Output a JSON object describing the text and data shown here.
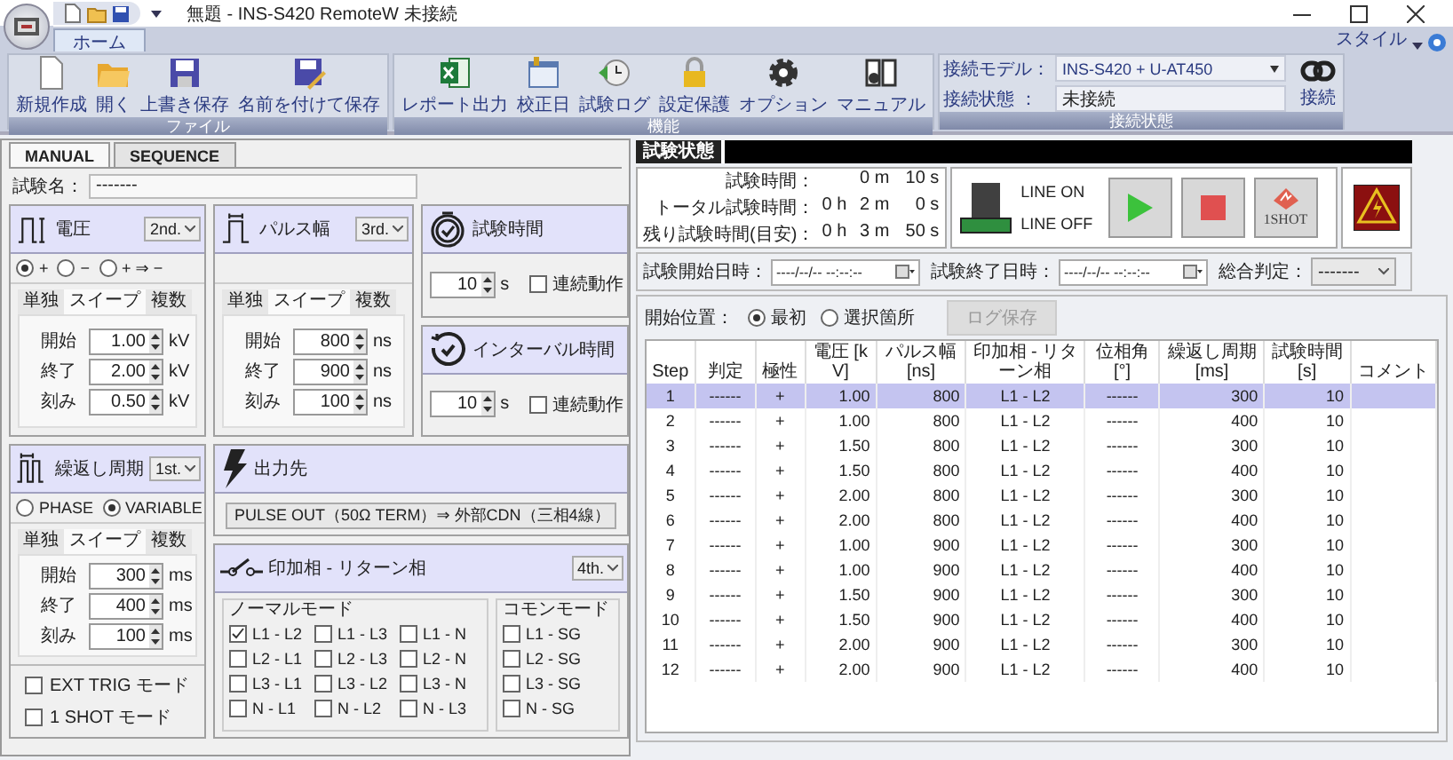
{
  "window": {
    "title": "無題 - INS-S420 RemoteW 未接続"
  },
  "ribbon": {
    "tabs": [
      {
        "label": "ホーム",
        "selected": true
      }
    ],
    "style_menu": "スタイル",
    "groups": [
      {
        "label": "ファイル",
        "buttons": [
          {
            "kind": "new",
            "label": "新規作成"
          },
          {
            "kind": "open",
            "label": "開く"
          },
          {
            "kind": "save",
            "label": "上書き保存"
          },
          {
            "kind": "save_as",
            "label": "名前を付けて保存"
          }
        ]
      },
      {
        "label": "機能",
        "buttons": [
          {
            "kind": "report",
            "label": "レポート出力"
          },
          {
            "kind": "calibration",
            "label": "校正日"
          },
          {
            "kind": "log",
            "label": "試験ログ"
          },
          {
            "kind": "lock",
            "label": "設定保護"
          },
          {
            "kind": "options",
            "label": "オプション"
          },
          {
            "kind": "manual",
            "label": "マニュアル"
          }
        ]
      }
    ],
    "connection": {
      "label": "接続状態",
      "model_label": "接続モデル：",
      "model": "INS-S420 + U-AT450",
      "state_label": "接続状態 ：",
      "state": "未接続",
      "connect": "接続"
    }
  },
  "modes": [
    {
      "label": "MANUAL",
      "selected": true
    },
    {
      "label": "SEQUENCE",
      "selected": false
    }
  ],
  "test_name": {
    "label": "試験名：",
    "value": "-------"
  },
  "parameter_panels": [
    {
      "kind": "voltage",
      "title": "電圧",
      "order": "2nd.",
      "options": [
        {
          "label": "+",
          "selected": true
        },
        {
          "label": "−",
          "selected": false
        },
        {
          "label": "+ ⇒ −",
          "selected": false
        }
      ],
      "tabs": [
        {
          "label": "単独",
          "selected": false
        },
        {
          "label": "スイープ",
          "selected": true
        },
        {
          "label": "複数",
          "selected": false
        }
      ],
      "fields": [
        {
          "label": "開始",
          "value": "1.00",
          "unit": "kV"
        },
        {
          "label": "終了",
          "value": "2.00",
          "unit": "kV"
        },
        {
          "label": "刻み",
          "value": "0.50",
          "unit": "kV"
        }
      ]
    },
    {
      "kind": "pulse_width",
      "title": "パルス幅",
      "order": "3rd.",
      "tabs": [
        {
          "label": "単独",
          "selected": false
        },
        {
          "label": "スイープ",
          "selected": true
        },
        {
          "label": "複数",
          "selected": false
        }
      ],
      "fields": [
        {
          "label": "開始",
          "value": "800",
          "unit": "ns"
        },
        {
          "label": "終了",
          "value": "900",
          "unit": "ns"
        },
        {
          "label": "刻み",
          "value": "100",
          "unit": "ns"
        }
      ]
    },
    {
      "kind": "repeat_period",
      "title": "繰返し周期",
      "order": "1st.",
      "options": [
        {
          "label": "PHASE",
          "selected": false
        },
        {
          "label": "VARIABLE",
          "selected": true
        }
      ],
      "tabs": [
        {
          "label": "単独",
          "selected": false
        },
        {
          "label": "スイープ",
          "selected": true
        },
        {
          "label": "複数",
          "selected": false
        }
      ],
      "fields": [
        {
          "label": "開始",
          "value": "300",
          "unit": "ms"
        },
        {
          "label": "終了",
          "value": "400",
          "unit": "ms"
        },
        {
          "label": "刻み",
          "value": "100",
          "unit": "ms"
        }
      ],
      "checks": [
        {
          "label": "EXT TRIG モード",
          "checked": false
        },
        {
          "label": "1 SHOT モード",
          "checked": false
        }
      ]
    }
  ],
  "timers": [
    {
      "kind": "test_time",
      "title": "試験時間",
      "value": "10",
      "unit": "s",
      "continuous": {
        "label": "連続動作",
        "checked": false
      }
    },
    {
      "kind": "interval",
      "title": "インターバル時間",
      "value": "10",
      "unit": "s",
      "continuous": {
        "label": "連続動作",
        "checked": false
      }
    }
  ],
  "output": {
    "title": "出力先",
    "value": "PULSE OUT（50Ω TERM）⇒ 外部CDN（三相4線）"
  },
  "phase": {
    "title": "印加相 - リターン相",
    "order": "4th.",
    "normal_mode": {
      "label": "ノーマルモード",
      "items": [
        {
          "label": "L1 - L2",
          "checked": true
        },
        {
          "label": "L1 - L3",
          "checked": false
        },
        {
          "label": "L1 - N",
          "checked": false
        },
        {
          "label": "L2 - L1",
          "checked": false
        },
        {
          "label": "L2 - L3",
          "checked": false
        },
        {
          "label": "L2 - N",
          "checked": false
        },
        {
          "label": "L3 - L1",
          "checked": false
        },
        {
          "label": "L3 - L2",
          "checked": false
        },
        {
          "label": "L3 - N",
          "checked": false
        },
        {
          "label": "N - L1",
          "checked": false
        },
        {
          "label": "N - L2",
          "checked": false
        },
        {
          "label": "N - L3",
          "checked": false
        }
      ]
    },
    "common_mode": {
      "label": "コモンモード",
      "items": [
        {
          "label": "L1 - SG",
          "checked": false
        },
        {
          "label": "L2 - SG",
          "checked": false
        },
        {
          "label": "L3 - SG",
          "checked": false
        },
        {
          "label": "N - SG",
          "checked": false
        }
      ]
    }
  },
  "status": {
    "title": "試験状態",
    "times": [
      {
        "label": "試験時間：",
        "m": "0 m",
        "s": "10 s"
      },
      {
        "label": "トータル試験時間：",
        "h": "0 h",
        "m": "2 m",
        "s": "0 s"
      },
      {
        "label": "残り試験時間(目安)：",
        "h": "0 h",
        "m": "3 m",
        "s": "50 s"
      }
    ],
    "lamp": {
      "on_label": "LINE ON",
      "off_label": "LINE OFF",
      "on": false
    },
    "one_shot": "1SHOT",
    "start_label": "試験開始日時：",
    "start_value": "----/--/-- --:--:--",
    "end_label": "試験終了日時：",
    "end_value": "----/--/-- --:--:--",
    "verdict_label": "総合判定：",
    "verdict_value": "-------"
  },
  "log": {
    "position_label": "開始位置：",
    "positions": [
      {
        "label": "最初",
        "selected": true
      },
      {
        "label": "選択箇所",
        "selected": false
      }
    ],
    "save": {
      "label": "ログ保存",
      "disabled": true
    },
    "columns": [
      "Step",
      "判定",
      "極性",
      "電圧 [kV]",
      "パルス幅 [ns]",
      "印加相 - リターン相",
      "位相角 [°]",
      "繰返し周期 [ms]",
      "試験時間 [s]",
      "コメント"
    ],
    "rows": [
      {
        "selected": true,
        "cells": [
          "1",
          "------",
          "+",
          "1.00",
          "800",
          "L1 - L2",
          "------",
          "300",
          "10"
        ]
      },
      {
        "selected": false,
        "cells": [
          "2",
          "------",
          "+",
          "1.00",
          "800",
          "L1 - L2",
          "------",
          "400",
          "10"
        ]
      },
      {
        "selected": false,
        "cells": [
          "3",
          "------",
          "+",
          "1.50",
          "800",
          "L1 - L2",
          "------",
          "300",
          "10"
        ]
      },
      {
        "selected": false,
        "cells": [
          "4",
          "------",
          "+",
          "1.50",
          "800",
          "L1 - L2",
          "------",
          "400",
          "10"
        ]
      },
      {
        "selected": false,
        "cells": [
          "5",
          "------",
          "+",
          "2.00",
          "800",
          "L1 - L2",
          "------",
          "300",
          "10"
        ]
      },
      {
        "selected": false,
        "cells": [
          "6",
          "------",
          "+",
          "2.00",
          "800",
          "L1 - L2",
          "------",
          "400",
          "10"
        ]
      },
      {
        "selected": false,
        "cells": [
          "7",
          "------",
          "+",
          "1.00",
          "900",
          "L1 - L2",
          "------",
          "300",
          "10"
        ]
      },
      {
        "selected": false,
        "cells": [
          "8",
          "------",
          "+",
          "1.00",
          "900",
          "L1 - L2",
          "------",
          "400",
          "10"
        ]
      },
      {
        "selected": false,
        "cells": [
          "9",
          "------",
          "+",
          "1.50",
          "900",
          "L1 - L2",
          "------",
          "300",
          "10"
        ]
      },
      {
        "selected": false,
        "cells": [
          "10",
          "------",
          "+",
          "1.50",
          "900",
          "L1 - L2",
          "------",
          "400",
          "10"
        ]
      },
      {
        "selected": false,
        "cells": [
          "11",
          "------",
          "+",
          "2.00",
          "900",
          "L1 - L2",
          "------",
          "300",
          "10"
        ]
      },
      {
        "selected": false,
        "cells": [
          "12",
          "------",
          "+",
          "2.00",
          "900",
          "L1 - L2",
          "------",
          "400",
          "10"
        ]
      }
    ]
  }
}
